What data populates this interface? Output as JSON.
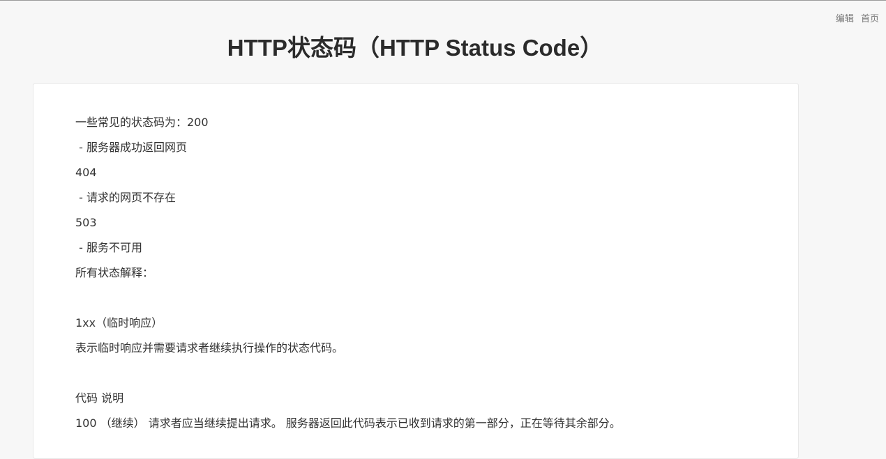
{
  "nav": {
    "edit_label": "编辑",
    "home_label": "首页"
  },
  "title": "HTTP状态码（HTTP Status Code）",
  "content": {
    "lines": [
      "一些常见的状态码为：200",
      " - 服务器成功返回网页",
      "404",
      " - 请求的网页不存在",
      "503",
      " - 服务不可用",
      "所有状态解释：",
      "",
      "1xx（临时响应）",
      "表示临时响应并需要请求者继续执行操作的状态代码。",
      "",
      "代码 说明",
      "100 （继续） 请求者应当继续提出请求。 服务器返回此代码表示已收到请求的第一部分，正在等待其余部分。"
    ]
  }
}
